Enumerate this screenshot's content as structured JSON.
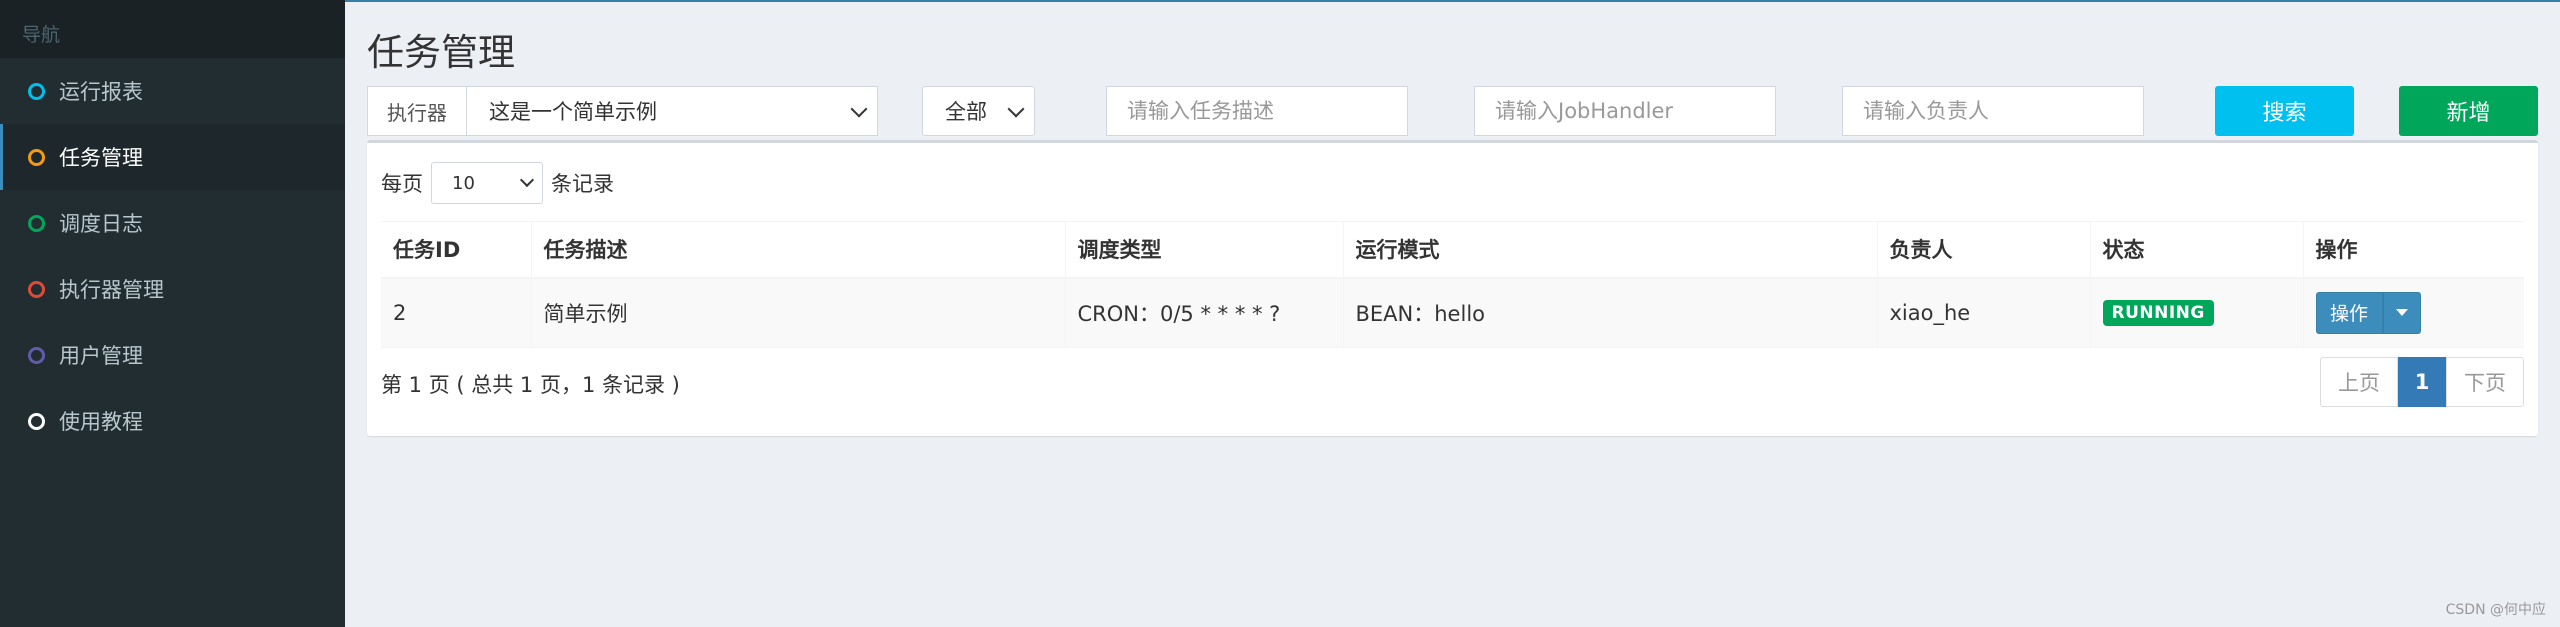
{
  "sidebar": {
    "header": "导航",
    "items": [
      {
        "label": "运行报表",
        "icon": "circle-icon",
        "color": "#00c0ef",
        "active": false
      },
      {
        "label": "任务管理",
        "icon": "circle-icon",
        "color": "#f39c12",
        "active": true
      },
      {
        "label": "调度日志",
        "icon": "circle-icon",
        "color": "#00a65a",
        "active": false
      },
      {
        "label": "执行器管理",
        "icon": "circle-icon",
        "color": "#dd4b39",
        "active": false
      },
      {
        "label": "用户管理",
        "icon": "circle-icon",
        "color": "#605ca8",
        "active": false
      },
      {
        "label": "使用教程",
        "icon": "circle-icon",
        "color": "#ffffff",
        "active": false
      }
    ]
  },
  "page": {
    "title": "任务管理"
  },
  "filters": {
    "executor_label": "执行器",
    "executor_value": "这是一个简单示例",
    "status_value": "全部",
    "desc_placeholder": "请输入任务描述",
    "handler_placeholder": "请输入JobHandler",
    "author_placeholder": "请输入负责人",
    "search_label": "搜索",
    "add_label": "新增"
  },
  "colors": {
    "search": "#00c0ef",
    "add": "#00a65a",
    "running": "#00a65a",
    "primary": "#3c8dbc"
  },
  "table": {
    "per_page_prefix": "每页",
    "per_page_value": "10",
    "per_page_suffix": "条记录",
    "headers": [
      "任务ID",
      "任务描述",
      "调度类型",
      "运行模式",
      "负责人",
      "状态",
      "操作"
    ],
    "rows": [
      {
        "id": "2",
        "desc": "简单示例",
        "schedule": "CRON：0/5 * * * * ?",
        "mode": "BEAN：hello",
        "author": "xiao_he",
        "status": "RUNNING",
        "action": "操作"
      }
    ],
    "info": "第 1 页 ( 总共 1 页，1 条记录 )"
  },
  "pagination": {
    "prev": "上页",
    "current": "1",
    "next": "下页"
  },
  "watermark": "CSDN @何中应"
}
